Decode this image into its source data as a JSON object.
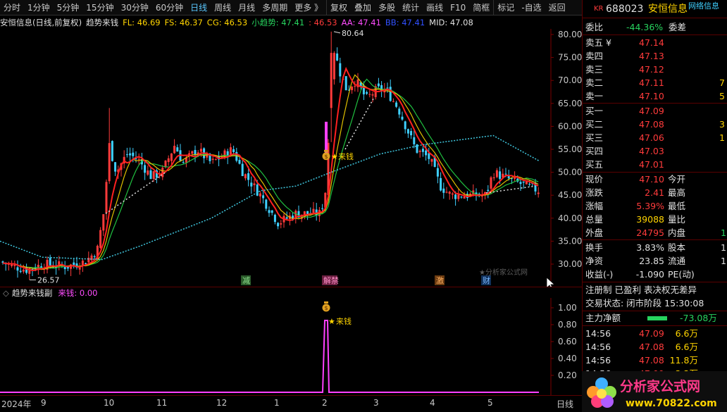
{
  "toolbar": {
    "items": [
      "分时",
      "1分钟",
      "5分钟",
      "15分钟",
      "30分钟",
      "60分钟",
      "日线",
      "周线",
      "月线",
      "多周期",
      "更多 》",
      "复权",
      "叠加",
      "多股",
      "统计",
      "画线",
      "F10",
      "简框",
      "标记",
      "-自选",
      "返回"
    ],
    "active_index": 6
  },
  "title": {
    "stock": "安恒信息(日线,前复权)",
    "indicator": "趋势来钱",
    "fl": "FL: 46.69",
    "fs": "FS: 46.37",
    "cg": "CG: 46.53",
    "xqs": "小趋势: 47.41",
    "neg": ": 46.53",
    "aa": "AA: 47.41",
    "bb": "BB: 47.41",
    "mid": "MID: 47.08"
  },
  "main_axis": [
    "80.00",
    "75.00",
    "70.00",
    "65.00",
    "60.00",
    "55.00",
    "50.00",
    "45.00",
    "40.00",
    "35.00",
    "30.00"
  ],
  "annotations": {
    "high": "80.64",
    "low": "26.57",
    "signal": "来钱",
    "events": [
      "减",
      "解禁",
      "激",
      "财"
    ],
    "watermark_text": "★分析家公式网"
  },
  "subchart": {
    "title": "趋势来钱副",
    "label": "来钱: 0.00",
    "axis": [
      "1.00",
      "0.80",
      "0.60",
      "0.40",
      "0.20"
    ],
    "signal": "来钱"
  },
  "dates": {
    "labels": [
      "2024年",
      "9",
      "10",
      "11",
      "12",
      "1",
      "2",
      "3",
      "4",
      "5"
    ],
    "period": "日线"
  },
  "quote": {
    "code": "688023",
    "name": "安恒信息",
    "badge": "KR",
    "shrink": "网络信息",
    "weibi_label": "委比",
    "weibi": "-44.36%",
    "weicha_label": "委差",
    "asks": [
      {
        "label": "卖五 ¥",
        "price": "47.14"
      },
      {
        "label": "卖四",
        "price": "47.13"
      },
      {
        "label": "卖三",
        "price": "47.12"
      },
      {
        "label": "卖二",
        "price": "47.11",
        "vol": "7"
      },
      {
        "label": "卖一",
        "price": "47.10",
        "vol": "5"
      }
    ],
    "bids": [
      {
        "label": "买一",
        "price": "47.09"
      },
      {
        "label": "买二",
        "price": "47.08",
        "vol": "3"
      },
      {
        "label": "买三",
        "price": "47.06",
        "vol": "1"
      },
      {
        "label": "买四",
        "price": "47.03"
      },
      {
        "label": "买五",
        "price": "47.01"
      }
    ],
    "stats": [
      {
        "l1": "现价",
        "v1": "47.10",
        "c1": "red",
        "l2": "今开",
        "v2": ""
      },
      {
        "l1": "涨跌",
        "v1": "2.41",
        "c1": "red",
        "l2": "最高",
        "v2": ""
      },
      {
        "l1": "涨幅",
        "v1": "5.39%",
        "c1": "red",
        "l2": "最低",
        "v2": ""
      },
      {
        "l1": "总量",
        "v1": "39088",
        "c1": "yellow",
        "l2": "量比",
        "v2": ""
      },
      {
        "l1": "外盘",
        "v1": "24795",
        "c1": "red",
        "l2": "内盘",
        "v2": "1"
      }
    ],
    "stats2": [
      {
        "l1": "换手",
        "v1": "3.83%",
        "l2": "股本",
        "v2": "1"
      },
      {
        "l1": "净资",
        "v1": "23.85",
        "l2": "流通",
        "v2": "1"
      },
      {
        "l1": "收益(-)",
        "v1": "-1.090",
        "l2": "PE(动)",
        "v2": ""
      }
    ],
    "flags": "注册制  已盈利  表决权无差异",
    "status": "交易状态: 闭市阶段 15:30:08",
    "net_label": "主力净额",
    "net_value": "-73.08万",
    "ticks": [
      {
        "time": "14:56",
        "price": "47.09",
        "vol": "6.6万",
        "pc": "red"
      },
      {
        "time": "14:56",
        "price": "47.08",
        "vol": "6.6万",
        "pc": "red"
      },
      {
        "time": "14:56",
        "price": "47.08",
        "vol": "11.8万",
        "pc": "red"
      },
      {
        "time": "14:56",
        "price": "47.09",
        "vol": "3.3万",
        "pc": "red"
      }
    ],
    "logo_text": "分析家公式网",
    "logo_url": "www.70822.com"
  },
  "colors": {
    "up": "#ff3b3b",
    "down": "#3fd0ff",
    "ma_red": "#ff2020",
    "ma_yellow": "#e0c000",
    "ma_green": "#20c040",
    "dotted": "#40c8e0",
    "signal": "#ff40ff"
  }
}
